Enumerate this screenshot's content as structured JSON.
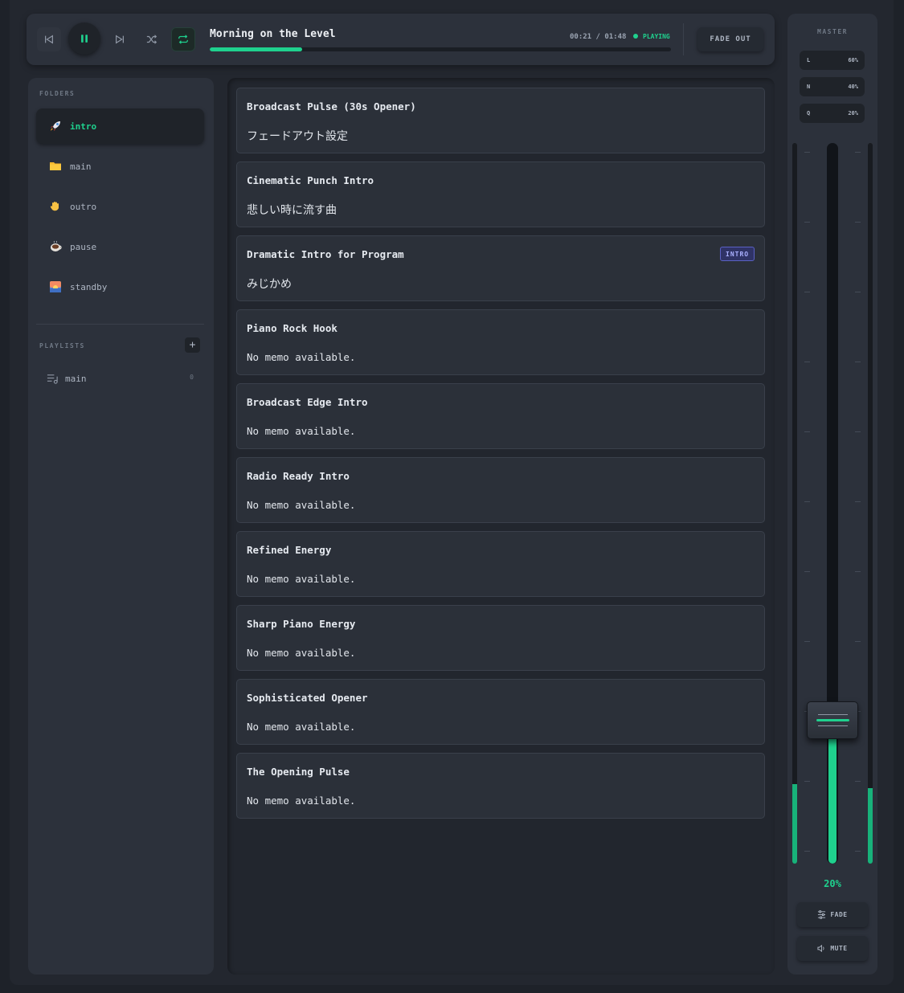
{
  "transport": {
    "track_title": "Morning on the Level",
    "time": "00:21 / 01:48",
    "status": "PLAYING",
    "progress": 0.2,
    "fade_out_label": "FADE OUT"
  },
  "sidebar": {
    "folders_label": "FOLDERS",
    "folders": [
      {
        "label": "intro",
        "icon": "rocket-icon",
        "active": true
      },
      {
        "label": "main",
        "icon": "folder-icon"
      },
      {
        "label": "outro",
        "icon": "waving-hand-icon"
      },
      {
        "label": "pause",
        "icon": "coffee-icon"
      },
      {
        "label": "standby",
        "icon": "sunrise-icon"
      }
    ],
    "playlists_label": "PLAYLISTS",
    "add_playlist_label": "+",
    "playlists": [
      {
        "label": "main",
        "count": "0"
      }
    ]
  },
  "tracks": [
    {
      "title": "Broadcast Pulse (30s Opener)",
      "memo": "フェードアウト設定"
    },
    {
      "title": "Cinematic Punch Intro",
      "memo": "悲しい時に流す曲"
    },
    {
      "title": "Dramatic Intro for Program",
      "memo": "みじかめ",
      "badge": "INTRO"
    },
    {
      "title": "Piano Rock Hook",
      "memo": "No memo available."
    },
    {
      "title": "Broadcast Edge Intro",
      "memo": "No memo available."
    },
    {
      "title": "Radio Ready Intro",
      "memo": "No memo available."
    },
    {
      "title": "Refined Energy",
      "memo": "No memo available."
    },
    {
      "title": "Sharp Piano Energy",
      "memo": "No memo available."
    },
    {
      "title": "Sophisticated Opener",
      "memo": "No memo available."
    },
    {
      "title": "The Opening Pulse",
      "memo": "No memo available."
    }
  ],
  "mixer": {
    "label": "MASTER",
    "eq": [
      {
        "key": "L",
        "value": "60%"
      },
      {
        "key": "N",
        "value": "40%"
      },
      {
        "key": "Q",
        "value": "20%"
      }
    ],
    "volume": "20%",
    "volume_level": 0.2,
    "meter_left_level": 0.11,
    "meter_right_level": 0.105,
    "fade_label": "FADE",
    "mute_label": "MUTE"
  },
  "colors": {
    "accent": "#1fd18e",
    "badge": "#5a61c4"
  }
}
